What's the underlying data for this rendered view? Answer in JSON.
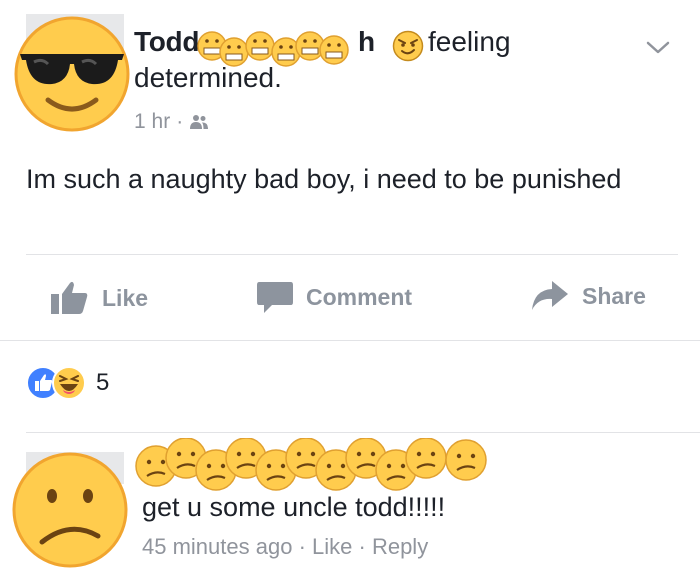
{
  "post": {
    "author_name_start": "Todd",
    "author_name_end": "h",
    "feeling_label": "feeling",
    "feeling_object": "determined.",
    "time": "1 hr",
    "separator": "·",
    "privacy_icon": "friends-icon",
    "body": "Im such a naughty bad boy, i need to be punished"
  },
  "actions": {
    "like": "Like",
    "comment": "Comment",
    "share": "Share"
  },
  "reactions": {
    "icons": [
      "like-reaction-icon",
      "haha-reaction-icon"
    ],
    "count": "5"
  },
  "comment": {
    "text": "get u some uncle todd!!!!!",
    "time": "45 minutes ago",
    "sep1": "·",
    "like": "Like",
    "sep2": "·",
    "reply": "Reply"
  },
  "colors": {
    "like_blue": "#4080ff",
    "emoji_yellow": "#ffcc4d",
    "muted": "#90949c",
    "action_grey": "#8d949e"
  }
}
